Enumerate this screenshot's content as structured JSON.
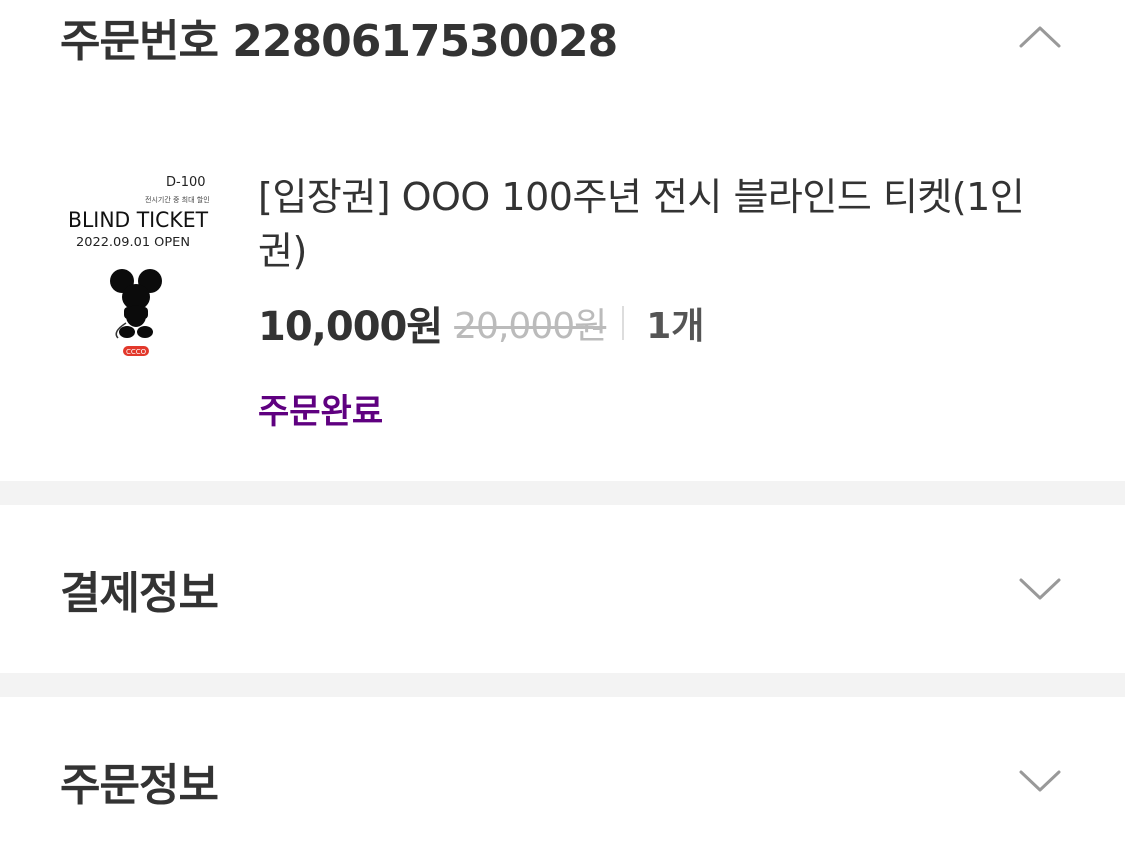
{
  "order": {
    "title": "주문번호 2280617530028",
    "expanded": true
  },
  "product": {
    "thumbnail": {
      "dday": "D-100",
      "subtitle": "전시기간 중 최대 할인",
      "title": "BLIND TICKET",
      "date": "2022.09.01 OPEN",
      "logo": "CCCO"
    },
    "name": "[입장권] OOO 100주년 전시 블라인드 티켓(1인권)",
    "price": "10,000원",
    "original_price": "20,000원",
    "quantity": "1개",
    "status": "주문완료",
    "status_color": "#5f0080"
  },
  "payment": {
    "title": "결제정보"
  },
  "order_info": {
    "title": "주문정보"
  },
  "icons": {
    "collapse": "chevron-up-icon",
    "expand": "chevron-down-icon"
  }
}
